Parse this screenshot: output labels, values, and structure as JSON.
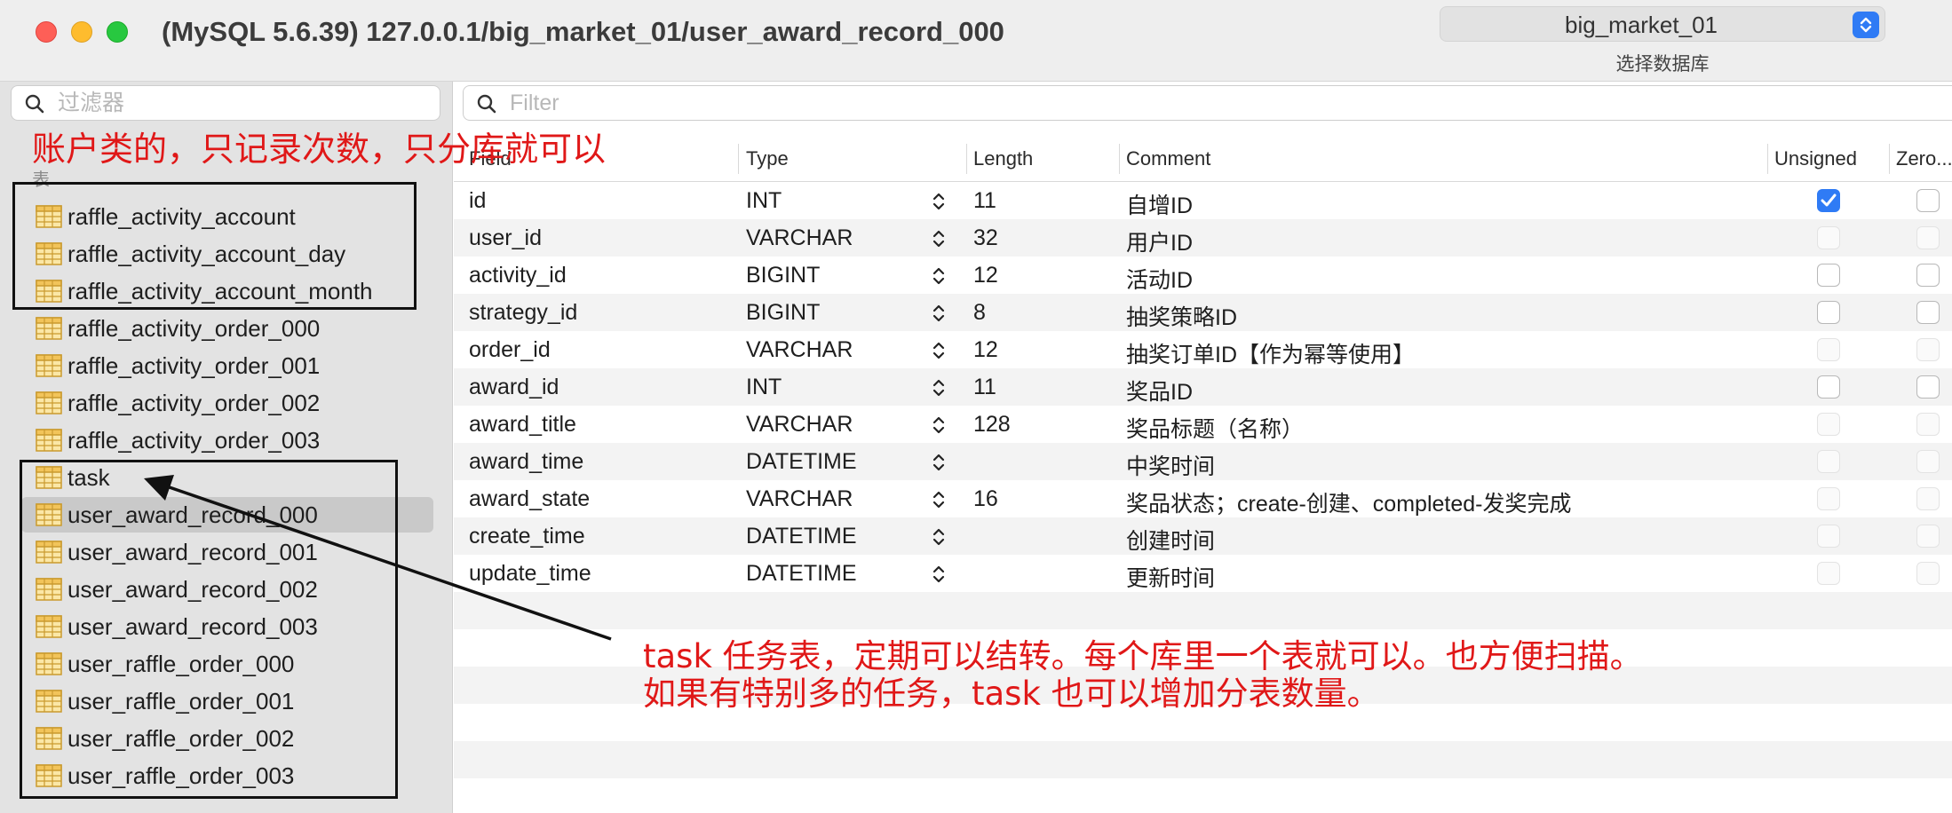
{
  "window": {
    "title": "(MySQL 5.6.39) 127.0.0.1/big_market_01/user_award_record_000"
  },
  "database_selector": {
    "value": "big_market_01",
    "caption": "选择数据库"
  },
  "sidebar": {
    "filter_placeholder": "过滤器",
    "tables_label": "表",
    "tables": [
      {
        "name": "raffle_activity_account",
        "selected": false
      },
      {
        "name": "raffle_activity_account_day",
        "selected": false
      },
      {
        "name": "raffle_activity_account_month",
        "selected": false
      },
      {
        "name": "raffle_activity_order_000",
        "selected": false
      },
      {
        "name": "raffle_activity_order_001",
        "selected": false
      },
      {
        "name": "raffle_activity_order_002",
        "selected": false
      },
      {
        "name": "raffle_activity_order_003",
        "selected": false
      },
      {
        "name": "task",
        "selected": false
      },
      {
        "name": "user_award_record_000",
        "selected": true
      },
      {
        "name": "user_award_record_001",
        "selected": false
      },
      {
        "name": "user_award_record_002",
        "selected": false
      },
      {
        "name": "user_award_record_003",
        "selected": false
      },
      {
        "name": "user_raffle_order_000",
        "selected": false
      },
      {
        "name": "user_raffle_order_001",
        "selected": false
      },
      {
        "name": "user_raffle_order_002",
        "selected": false
      },
      {
        "name": "user_raffle_order_003",
        "selected": false
      }
    ]
  },
  "structure": {
    "filter_placeholder": "Filter",
    "columns": {
      "field": "Field",
      "type": "Type",
      "length": "Length",
      "comment": "Comment",
      "unsigned": "Unsigned",
      "zerofill": "Zero..."
    },
    "rows": [
      {
        "field": "id",
        "type": "INT",
        "length": "11",
        "comment": "自增ID",
        "unsigned": "checked",
        "zerofill": "unchecked"
      },
      {
        "field": "user_id",
        "type": "VARCHAR",
        "length": "32",
        "comment": "用户ID",
        "unsigned": "disabled",
        "zerofill": "disabled"
      },
      {
        "field": "activity_id",
        "type": "BIGINT",
        "length": "12",
        "comment": "活动ID",
        "unsigned": "unchecked",
        "zerofill": "unchecked"
      },
      {
        "field": "strategy_id",
        "type": "BIGINT",
        "length": "8",
        "comment": "抽奖策略ID",
        "unsigned": "unchecked",
        "zerofill": "unchecked"
      },
      {
        "field": "order_id",
        "type": "VARCHAR",
        "length": "12",
        "comment": "抽奖订单ID【作为幂等使用】",
        "unsigned": "disabled",
        "zerofill": "disabled"
      },
      {
        "field": "award_id",
        "type": "INT",
        "length": "11",
        "comment": "奖品ID",
        "unsigned": "unchecked",
        "zerofill": "unchecked"
      },
      {
        "field": "award_title",
        "type": "VARCHAR",
        "length": "128",
        "comment": "奖品标题（名称）",
        "unsigned": "disabled",
        "zerofill": "disabled"
      },
      {
        "field": "award_time",
        "type": "DATETIME",
        "length": "",
        "comment": "中奖时间",
        "unsigned": "disabled",
        "zerofill": "disabled"
      },
      {
        "field": "award_state",
        "type": "VARCHAR",
        "length": "16",
        "comment": "奖品状态；create-创建、completed-发奖完成",
        "unsigned": "disabled",
        "zerofill": "disabled"
      },
      {
        "field": "create_time",
        "type": "DATETIME",
        "length": "",
        "comment": "创建时间",
        "unsigned": "disabled",
        "zerofill": "disabled"
      },
      {
        "field": "update_time",
        "type": "DATETIME",
        "length": "",
        "comment": "更新时间",
        "unsigned": "disabled",
        "zerofill": "disabled"
      }
    ]
  },
  "annotations": {
    "top": "账户类的，只记录次数，只分库就可以",
    "bottom_line1": "task 任务表，定期可以结转。每个库里一个表就可以。也方便扫描。",
    "bottom_line2": "如果有特别多的任务，task 也可以增加分表数量。"
  },
  "colors": {
    "annotation_red": "#e01818",
    "accent_blue": "#2f7bf5",
    "selected_row": "#c9c9c9",
    "sidebar_bg": "#e3e3e3"
  },
  "icons": {
    "search": "magnifier-icon",
    "table": "table-grid-icon",
    "stepper": "up-down-chevron-icon",
    "checkmark": "check-icon"
  }
}
